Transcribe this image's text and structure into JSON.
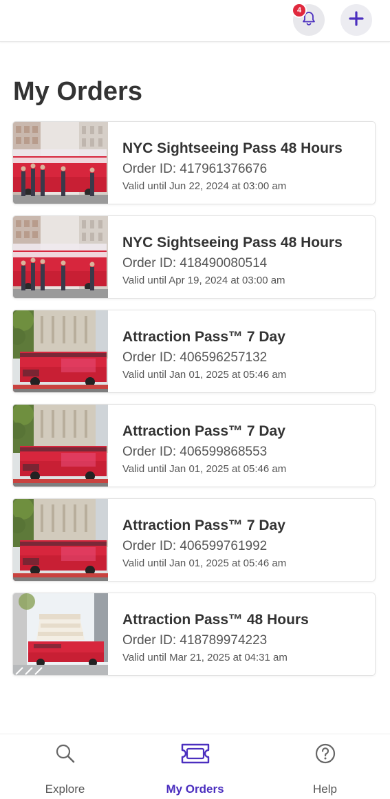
{
  "header": {
    "notification_count": "4",
    "bell_icon": "bell-icon",
    "add_icon": "plus-icon"
  },
  "page_title": "My Orders",
  "orders": [
    {
      "title": "NYC Sightseeing Pass 48 Hours",
      "order_id": "Order ID: 417961376676",
      "valid": "Valid until Jun 22, 2024 at 03:00 am",
      "image": "people-with-red-bus"
    },
    {
      "title": "NYC Sightseeing Pass 48 Hours",
      "order_id": "Order ID: 418490080514",
      "valid": "Valid until Apr 19, 2024 at 03:00 am",
      "image": "people-with-red-bus"
    },
    {
      "title": "Attraction Pass™ 7 Day",
      "order_id": "Order ID: 406596257132",
      "valid": "Valid until Jan 01, 2025 at 05:46 am",
      "image": "red-bus-by-library"
    },
    {
      "title": "Attraction Pass™ 7 Day",
      "order_id": "Order ID: 406599868553",
      "valid": "Valid until Jan 01, 2025 at 05:46 am",
      "image": "red-bus-by-library"
    },
    {
      "title": "Attraction Pass™ 7 Day",
      "order_id": "Order ID: 406599761992",
      "valid": "Valid until Jan 01, 2025 at 05:46 am",
      "image": "red-bus-by-library"
    },
    {
      "title": "Attraction Pass™ 48 Hours",
      "order_id": "Order ID: 418789974223",
      "valid": "Valid until Mar 21, 2025 at 04:31 am",
      "image": "red-bus-by-guggenheim"
    }
  ],
  "nav": [
    {
      "label": "Explore",
      "icon": "search-icon",
      "active": false
    },
    {
      "label": "My Orders",
      "icon": "ticket-icon",
      "active": true
    },
    {
      "label": "Help",
      "icon": "help-icon",
      "active": false
    }
  ],
  "colors": {
    "accent": "#4b2fbf",
    "badge": "#e0293e",
    "bus_red": "#d7263d"
  }
}
